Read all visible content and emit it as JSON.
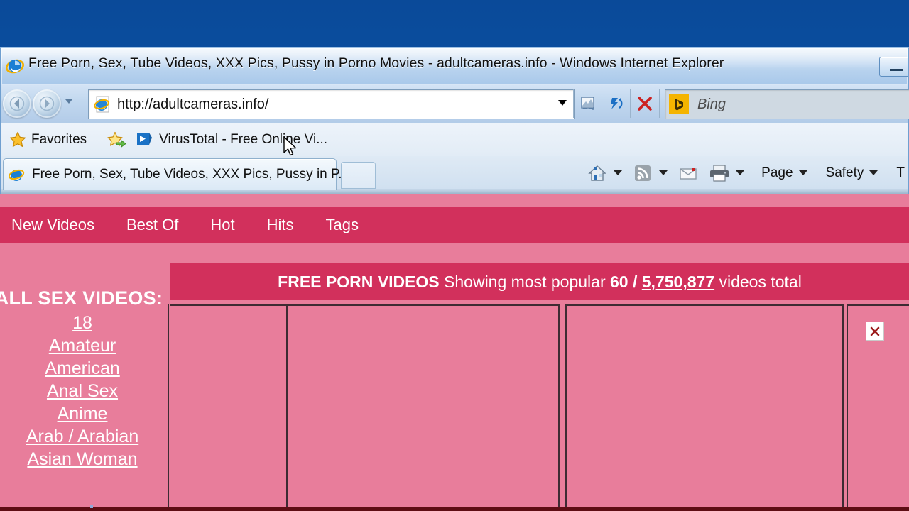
{
  "window": {
    "title": "Free Porn, Sex, Tube Videos, XXX Pics, Pussy in Porno Movies - adultcameras.info - Windows Internet Explorer",
    "minimize_label": ""
  },
  "navigation": {
    "back_tooltip": "Back",
    "forward_tooltip": "Forward",
    "recent_pages_tooltip": "Recent Pages",
    "address_value": "http://adultcameras.info/",
    "compatibility_tooltip": "Compatibility View",
    "refresh_tooltip": "Refresh",
    "stop_tooltip": "Stop"
  },
  "search": {
    "provider": "Bing",
    "placeholder": "Bing",
    "provider_glyph": "b"
  },
  "favorites_bar": {
    "favorites_label": "Favorites",
    "add_tooltip": "Add to Favorites Bar",
    "items": [
      {
        "label": "VirusTotal - Free Online Vi...",
        "icon": "virustotal-icon"
      }
    ]
  },
  "tabs": [
    {
      "label": "Free Porn, Sex, Tube Videos, XXX Pics, Pussy in P...",
      "active": true
    }
  ],
  "new_tab": {
    "tooltip": "New Tab"
  },
  "command_bar": {
    "home_tooltip": "Home",
    "feeds_tooltip": "Feeds",
    "mail_tooltip": "Read Mail",
    "print_tooltip": "Print",
    "page_label": "Page",
    "safety_label": "Safety",
    "tools_label": "T"
  },
  "site": {
    "nav": [
      {
        "label": "New Videos"
      },
      {
        "label": "Best Of"
      },
      {
        "label": "Hot"
      },
      {
        "label": "Hits"
      },
      {
        "label": "Tags"
      }
    ],
    "sidebar": {
      "heading": "ALL SEX VIDEOS:",
      "links": [
        {
          "label": "18"
        },
        {
          "label": "Amateur"
        },
        {
          "label": "American"
        },
        {
          "label": "Anal Sex"
        },
        {
          "label": "Anime"
        },
        {
          "label": "Arab / Arabian"
        },
        {
          "label": "Asian Woman"
        }
      ]
    },
    "content_header": {
      "title": "FREE PORN VIDEOS",
      "showing_text": "Showing most popular",
      "shown_count": "60",
      "separator": "/",
      "total_count": "5,750,877",
      "suffix": "videos total"
    },
    "thumbnails": [
      {
        "name": "thumb-slot-1",
        "broken": false
      },
      {
        "name": "thumb-slot-2",
        "broken": false
      },
      {
        "name": "thumb-slot-3",
        "broken": false
      },
      {
        "name": "thumb-slot-4",
        "broken": true
      }
    ]
  },
  "colors": {
    "site_pink": "#E87D9B",
    "site_crimson": "#D2305C",
    "site_border": "#3d2b33",
    "page_footer": "#5e0d14",
    "desktop_blue": "#0d56ac",
    "chrome_blue": "#b7d2ee"
  }
}
